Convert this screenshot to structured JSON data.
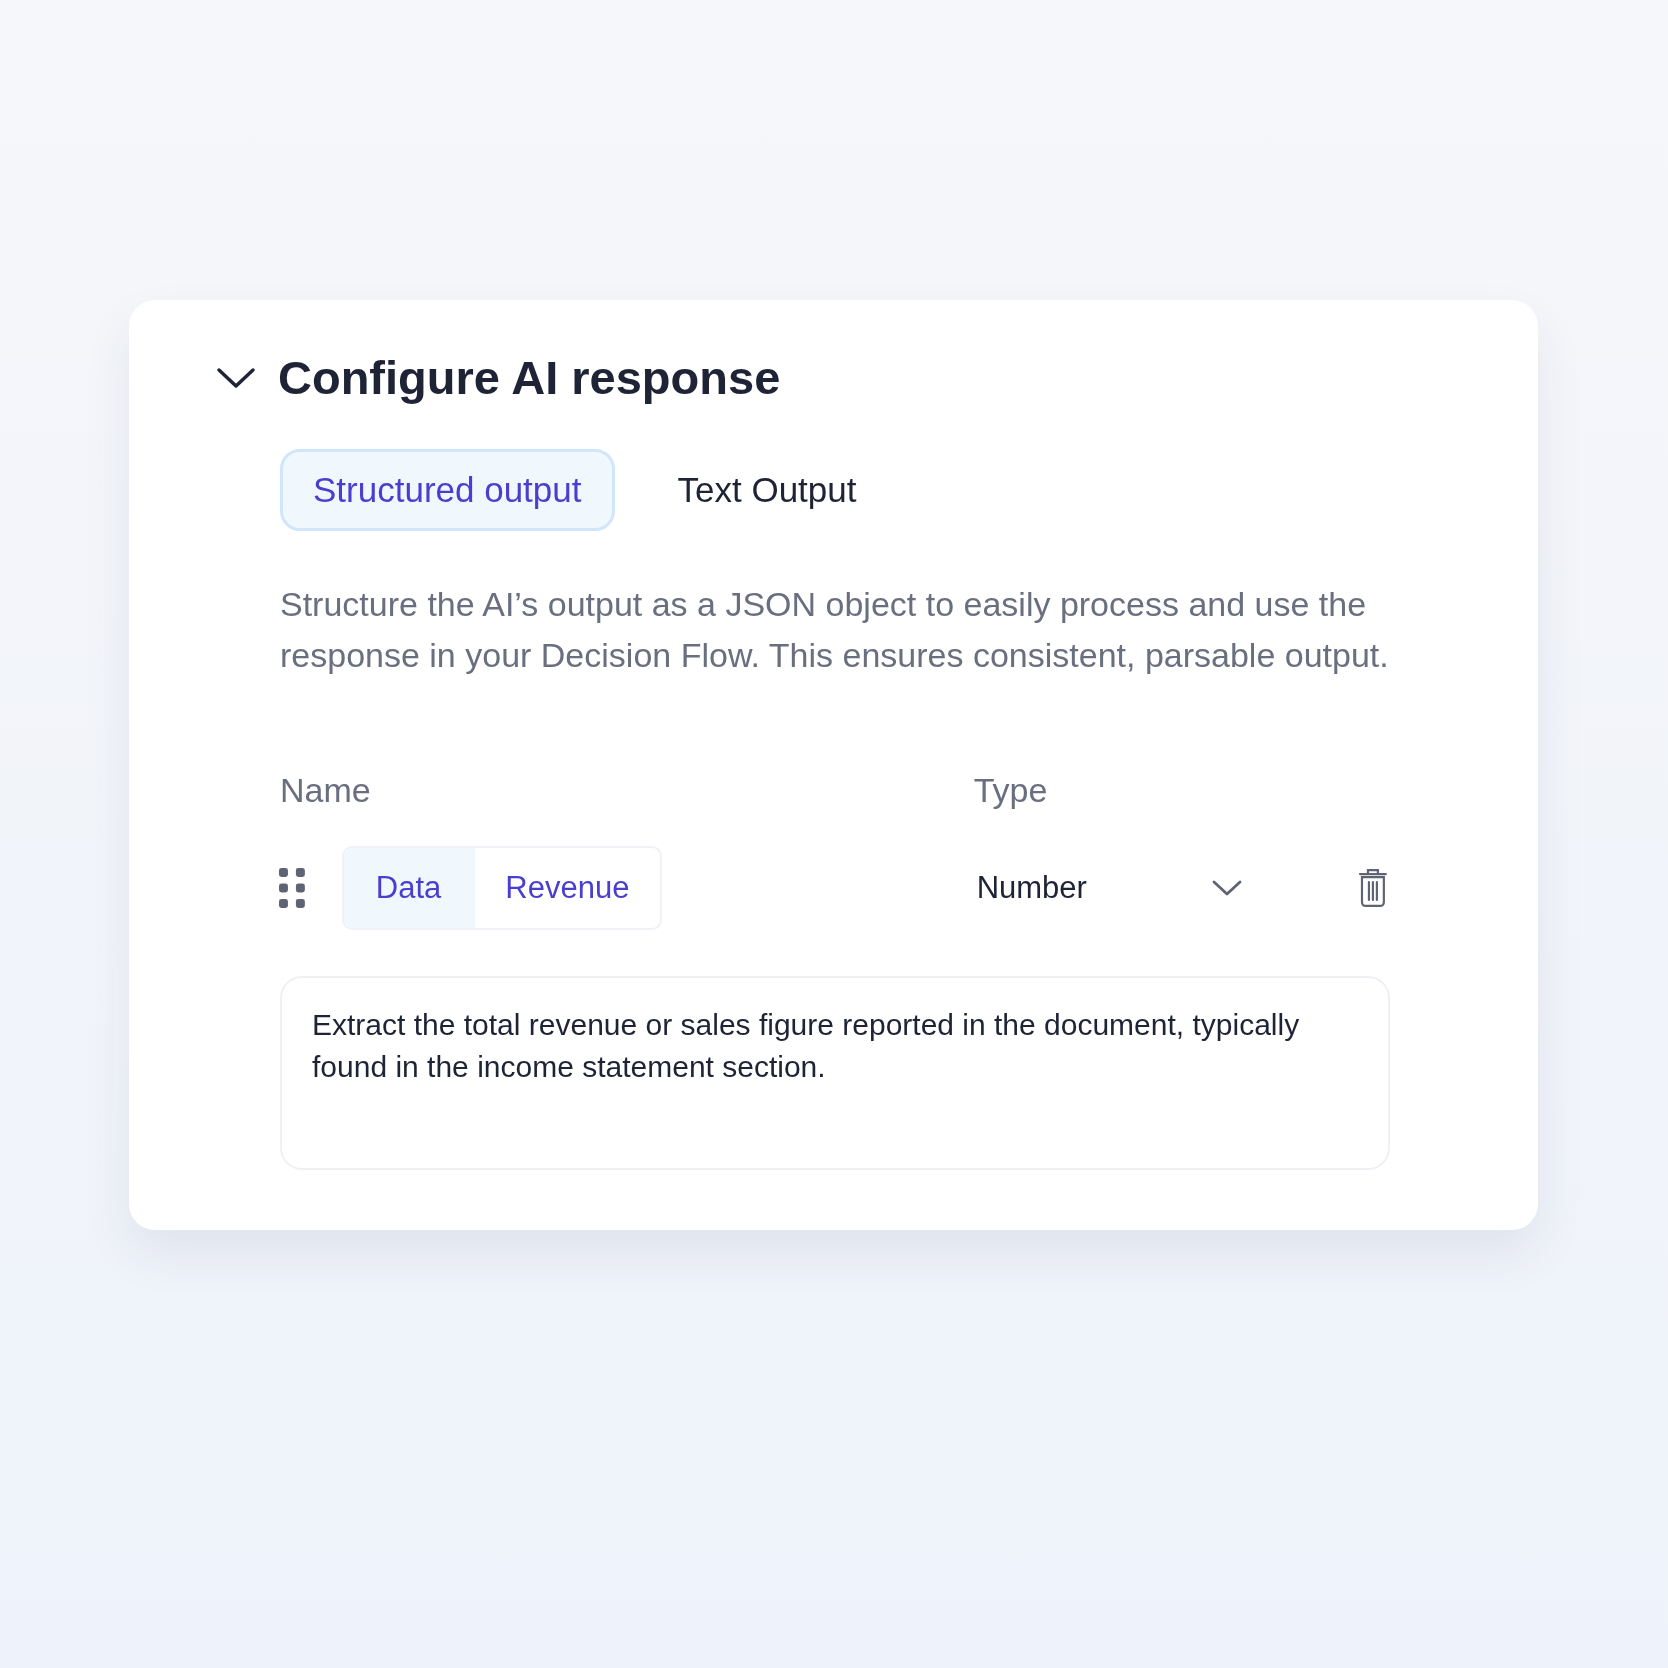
{
  "section": {
    "title": "Configure AI response",
    "expanded": true
  },
  "tabs": [
    {
      "label": "Structured output",
      "selected": true
    },
    {
      "label": "Text Output",
      "selected": false
    }
  ],
  "description": "Structure the AI’s output as a JSON object to easily process and use the response in your Decision Flow. This ensures consistent, parsable output.",
  "columns": [
    "Name",
    "Type"
  ],
  "fields": [
    {
      "prefix": "Data",
      "name": "Revenue",
      "type": "Number",
      "instructions": "Extract the total revenue or sales figure reported in the document, typically found in the income statement section."
    }
  ]
}
